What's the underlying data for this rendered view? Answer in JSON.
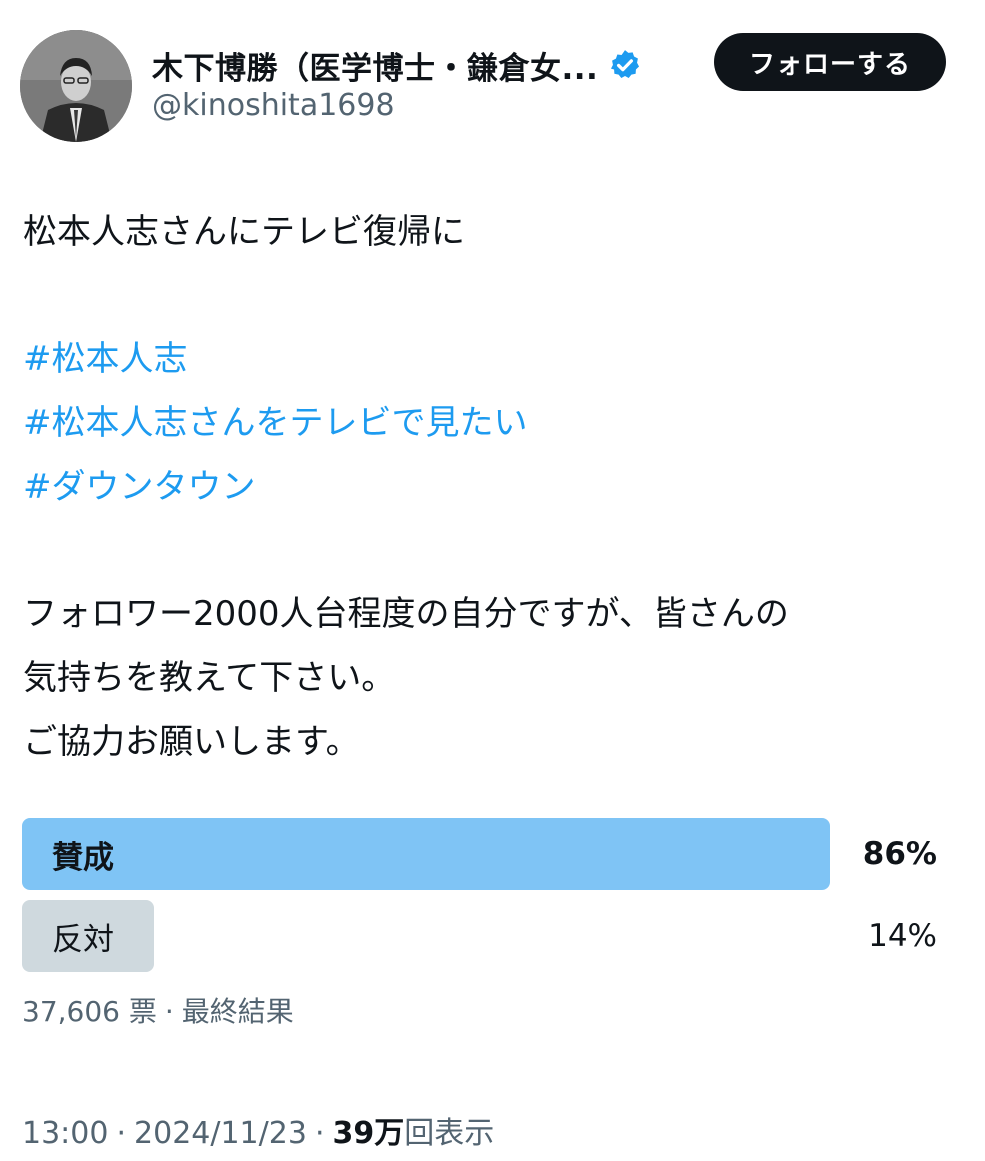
{
  "author": {
    "display_name": "木下博勝（医学博士・鎌倉女...",
    "handle": "@kinoshita1698",
    "verified_icon": "verified-badge-icon",
    "avatar_icon": "avatar"
  },
  "follow_button": {
    "label": "フォローする"
  },
  "tweet": {
    "line1": "松本人志さんにテレビ復帰に",
    "hashtags": [
      "#松本人志",
      "#松本人志さんをテレビで見たい",
      "#ダウンタウン"
    ],
    "line2": "フォロワー2000人台程度の自分ですが、皆さんの",
    "line3": "気持ちを教えて下さい。",
    "line4": "ご協力お願いします。"
  },
  "poll": {
    "options": [
      {
        "label": "賛成",
        "percent_text": "86%",
        "percent": 86
      },
      {
        "label": "反対",
        "percent_text": "14%",
        "percent": 14
      }
    ],
    "votes": "37,606 票",
    "separator": "·",
    "status": "最終結果"
  },
  "meta": {
    "time": "13:00",
    "date": "2024/11/23",
    "separator": "·",
    "views_count": "39万",
    "views_label": "回表示"
  },
  "colors": {
    "link": "#1d9bf0",
    "poll_winner": "#7fc4f5",
    "poll_other": "#cfd9de",
    "text_secondary": "#536471"
  }
}
